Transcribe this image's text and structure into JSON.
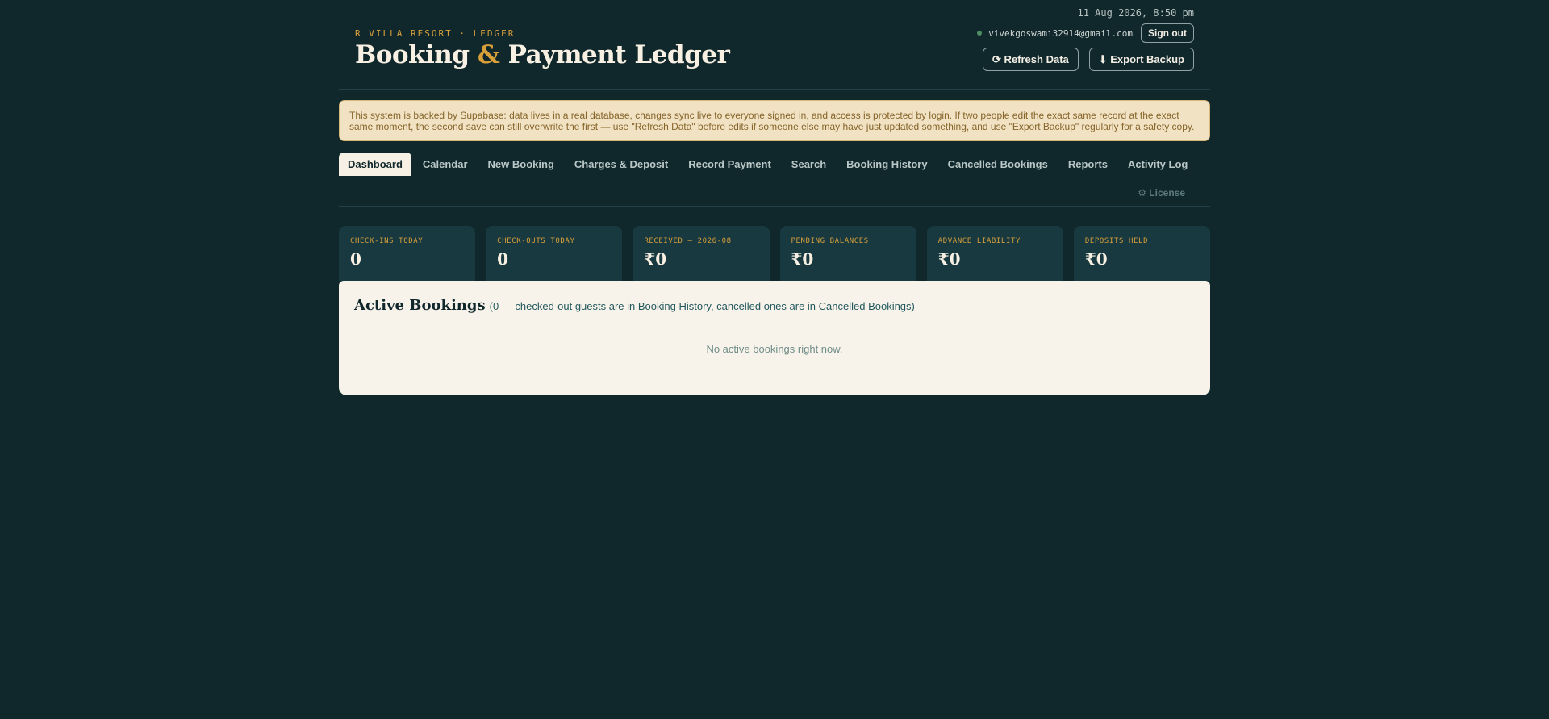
{
  "header": {
    "datetime": "11 Aug 2026, 8:50 pm",
    "eyebrow": "R VILLA RESORT · LEDGER",
    "title_part1": "Booking ",
    "title_amp": "&",
    "title_part2": " Payment Ledger",
    "user_email": "vivekgoswami32914@gmail.com",
    "sign_out_label": "Sign out",
    "refresh_label": "⟳ Refresh Data",
    "export_label": "⬇ Export Backup"
  },
  "notice": {
    "text": "This system is backed by Supabase: data lives in a real database, changes sync live to everyone signed in, and access is protected by login. If two people edit the exact same record at the exact same moment, the second save can still overwrite the first — use \"Refresh Data\" before edits if someone else may have just updated something, and use \"Export Backup\" regularly for a safety copy."
  },
  "tabs": [
    {
      "label": "Dashboard",
      "active": true
    },
    {
      "label": "Calendar",
      "active": false
    },
    {
      "label": "New Booking",
      "active": false
    },
    {
      "label": "Charges & Deposit",
      "active": false
    },
    {
      "label": "Record Payment",
      "active": false
    },
    {
      "label": "Search",
      "active": false
    },
    {
      "label": "Booking History",
      "active": false
    },
    {
      "label": "Cancelled Bookings",
      "active": false
    },
    {
      "label": "Reports",
      "active": false
    },
    {
      "label": "Activity Log",
      "active": false
    }
  ],
  "license_label": "⚙ License",
  "stats": [
    {
      "label": "CHECK-INS TODAY",
      "value": "0"
    },
    {
      "label": "CHECK-OUTS TODAY",
      "value": "0"
    },
    {
      "label": "RECEIVED — 2026-08",
      "value": "₹0"
    },
    {
      "label": "PENDING BALANCES",
      "value": "₹0"
    },
    {
      "label": "ADVANCE LIABILITY",
      "value": "₹0"
    },
    {
      "label": "DEPOSITS HELD",
      "value": "₹0"
    }
  ],
  "active_bookings": {
    "title": "Active Bookings",
    "subtitle": "(0 — checked-out guests are in Booking History, cancelled ones are in Cancelled Bookings)",
    "empty_text": "No active bookings right now."
  },
  "colors": {
    "background": "#10272c",
    "accent": "#d9a03a",
    "card": "#17393f",
    "panel": "#f8f3ea",
    "notice_bg": "#f1e2c3"
  }
}
